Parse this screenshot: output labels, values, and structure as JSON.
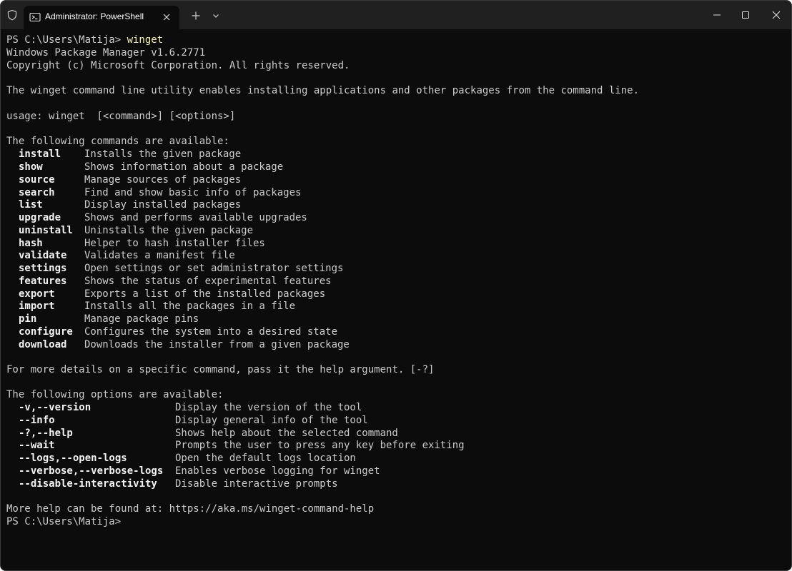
{
  "window": {
    "tab_title": "Administrator: PowerShell"
  },
  "terminal": {
    "prompt1": "PS C:\\Users\\Matija> ",
    "command1": "winget",
    "version_line": "Windows Package Manager v1.6.2771",
    "copyright_line": "Copyright (c) Microsoft Corporation. All rights reserved.",
    "description_line": "The winget command line utility enables installing applications and other packages from the command line.",
    "usage_line": "usage: winget  [<command>] [<options>]",
    "commands_header": "The following commands are available:",
    "commands": [
      {
        "name": "install",
        "desc": "Installs the given package"
      },
      {
        "name": "show",
        "desc": "Shows information about a package"
      },
      {
        "name": "source",
        "desc": "Manage sources of packages"
      },
      {
        "name": "search",
        "desc": "Find and show basic info of packages"
      },
      {
        "name": "list",
        "desc": "Display installed packages"
      },
      {
        "name": "upgrade",
        "desc": "Shows and performs available upgrades"
      },
      {
        "name": "uninstall",
        "desc": "Uninstalls the given package"
      },
      {
        "name": "hash",
        "desc": "Helper to hash installer files"
      },
      {
        "name": "validate",
        "desc": "Validates a manifest file"
      },
      {
        "name": "settings",
        "desc": "Open settings or set administrator settings"
      },
      {
        "name": "features",
        "desc": "Shows the status of experimental features"
      },
      {
        "name": "export",
        "desc": "Exports a list of the installed packages"
      },
      {
        "name": "import",
        "desc": "Installs all the packages in a file"
      },
      {
        "name": "pin",
        "desc": "Manage package pins"
      },
      {
        "name": "configure",
        "desc": "Configures the system into a desired state"
      },
      {
        "name": "download",
        "desc": "Downloads the installer from a given package"
      }
    ],
    "details_line": "For more details on a specific command, pass it the help argument. [-?]",
    "options_header": "The following options are available:",
    "options": [
      {
        "name": "-v,--version",
        "desc": "Display the version of the tool"
      },
      {
        "name": "--info",
        "desc": "Display general info of the tool"
      },
      {
        "name": "-?,--help",
        "desc": "Shows help about the selected command"
      },
      {
        "name": "--wait",
        "desc": "Prompts the user to press any key before exiting"
      },
      {
        "name": "--logs,--open-logs",
        "desc": "Open the default logs location"
      },
      {
        "name": "--verbose,--verbose-logs",
        "desc": "Enables verbose logging for winget"
      },
      {
        "name": "--disable-interactivity",
        "desc": "Disable interactive prompts"
      }
    ],
    "more_help_line": "More help can be found at: https://aka.ms/winget-command-help",
    "prompt2": "PS C:\\Users\\Matija>"
  },
  "icons": {
    "shield": "shield-icon",
    "tab": "powershell-icon",
    "tab_close": "close-icon",
    "new_tab": "plus-icon",
    "dropdown": "chevron-down-icon",
    "minimize": "minimize-icon",
    "maximize": "maximize-icon",
    "close": "close-icon"
  },
  "colors": {
    "terminal_bg": "#0c0c0c",
    "text": "#cccccc",
    "command_highlight": "#f9f1a5"
  }
}
